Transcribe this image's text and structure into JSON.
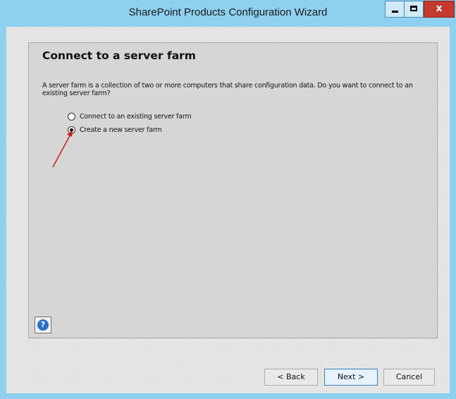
{
  "window": {
    "title": "SharePoint Products Configuration Wizard",
    "controls": {
      "minimize": "minimize",
      "maximize": "maximize",
      "close": "x"
    }
  },
  "page": {
    "heading": "Connect to a server farm",
    "description": "A server farm is a collection of two or more computers that share configuration data. Do you want to connect to an existing server farm?",
    "options": [
      {
        "label": "Connect to an existing server farm",
        "selected": false
      },
      {
        "label": "Create a new server farm",
        "selected": true
      }
    ],
    "annotation": "red-arrow"
  },
  "buttons": {
    "help": "?",
    "back": "< Back",
    "next": "Next >",
    "cancel": "Cancel"
  },
  "colors": {
    "titlebar": "#8fd0f0",
    "close_button": "#c43a30",
    "panel": "#d6d6d6",
    "arrow": "#c8201a",
    "help_icon": "#2a6fc9"
  }
}
